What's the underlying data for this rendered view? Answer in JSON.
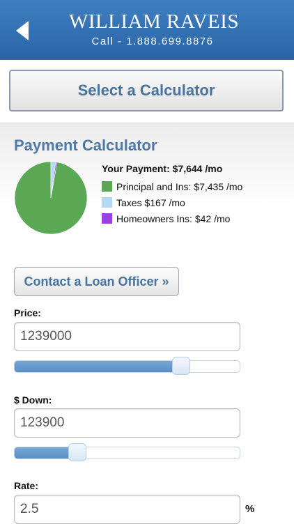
{
  "header": {
    "brand": "WILLIAM RAVEIS",
    "phone": "Call - 1.888.699.8876"
  },
  "select_button_label": "Select a Calculator",
  "calculator": {
    "title": "Payment Calculator",
    "your_payment": "Your Payment: $7,644 /mo",
    "legend": [
      {
        "label": "Principal and Ins: $7,435 /mo",
        "color": "#5aa854",
        "value": 7435
      },
      {
        "label": "Taxes $167 /mo",
        "color": "#b3daf2",
        "value": 167
      },
      {
        "label": "Homeowners Ins: $42 /mo",
        "color": "#9b3fe0",
        "value": 42
      }
    ]
  },
  "contact_button_label": "Contact a Loan Officer »",
  "fields": {
    "price": {
      "label": "Price:",
      "value": "1239000",
      "slider_fraction": 0.74
    },
    "down": {
      "label": "$ Down:",
      "value": "123900",
      "slider_fraction": 0.28
    },
    "rate": {
      "label": "Rate:",
      "value": "2.5",
      "suffix": "%"
    }
  },
  "colors": {
    "accent": "#47739e",
    "header": "#3370b3"
  }
}
